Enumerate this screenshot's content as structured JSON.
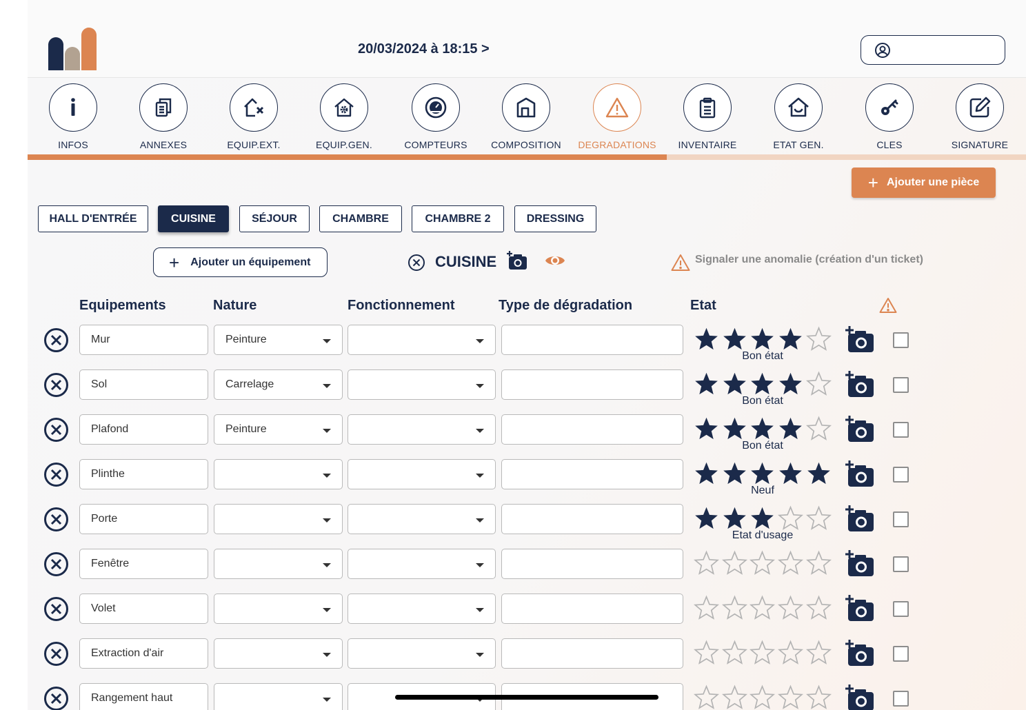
{
  "header": {
    "datetime": "20/03/2024 à 18:15 >",
    "user_name": ""
  },
  "colors": {
    "navy": "#1b2a4a",
    "accent": "#dc8551",
    "logo_mid": "#b2a291"
  },
  "steps": [
    {
      "label": "INFOS",
      "icon": "info-icon",
      "active": false
    },
    {
      "label": "ANNEXES",
      "icon": "documents-icon",
      "active": false
    },
    {
      "label": "EQUIP.EXT.",
      "icon": "house-exterior-icon",
      "active": false
    },
    {
      "label": "EQUIP.GEN.",
      "icon": "house-gear-icon",
      "active": false
    },
    {
      "label": "COMPTEURS",
      "icon": "gauge-icon",
      "active": false
    },
    {
      "label": "COMPOSITION",
      "icon": "floorplan-icon",
      "active": false
    },
    {
      "label": "DEGRADATIONS",
      "icon": "warning-icon",
      "active": true
    },
    {
      "label": "INVENTAIRE",
      "icon": "clipboard-icon",
      "active": false
    },
    {
      "label": "ETAT GEN.",
      "icon": "house-smile-icon",
      "active": false
    },
    {
      "label": "CLES",
      "icon": "key-icon",
      "active": false
    },
    {
      "label": "SIGNATURE",
      "icon": "edit-icon",
      "active": false
    }
  ],
  "progress": 0.64,
  "add_room_label": "Ajouter une pièce",
  "rooms": [
    {
      "label": "HALL D'ENTRÉE",
      "active": false
    },
    {
      "label": "CUISINE",
      "active": true
    },
    {
      "label": "SÉJOUR",
      "active": false
    },
    {
      "label": "CHAMBRE",
      "active": false
    },
    {
      "label": "CHAMBRE 2",
      "active": false
    },
    {
      "label": "DRESSING",
      "active": false
    }
  ],
  "add_equipment_label": "Ajouter un équipement",
  "current_room": "CUISINE",
  "anomaly_label": "Signaler une anomalie (création d'un ticket)",
  "columns": {
    "equipements": "Equipements",
    "nature": "Nature",
    "fonctionnement": "Fonctionnement",
    "degradation": "Type de dégradation",
    "etat": "Etat"
  },
  "rows": [
    {
      "equipement": "Mur",
      "nature": "Peinture",
      "fonctionnement": "",
      "degradation": "",
      "stars": 4,
      "etat": "Bon état",
      "checked": false
    },
    {
      "equipement": "Sol",
      "nature": "Carrelage",
      "fonctionnement": "",
      "degradation": "",
      "stars": 4,
      "etat": "Bon état",
      "checked": false
    },
    {
      "equipement": "Plafond",
      "nature": "Peinture",
      "fonctionnement": "",
      "degradation": "",
      "stars": 4,
      "etat": "Bon état",
      "checked": false
    },
    {
      "equipement": "Plinthe",
      "nature": "",
      "fonctionnement": "",
      "degradation": "",
      "stars": 5,
      "etat": "Neuf",
      "checked": false
    },
    {
      "equipement": "Porte",
      "nature": "",
      "fonctionnement": "",
      "degradation": "",
      "stars": 3,
      "etat": "Etat d'usage",
      "checked": false
    },
    {
      "equipement": "Fenêtre",
      "nature": "",
      "fonctionnement": "",
      "degradation": "",
      "stars": 0,
      "etat": "",
      "checked": false
    },
    {
      "equipement": "Volet",
      "nature": "",
      "fonctionnement": "",
      "degradation": "",
      "stars": 0,
      "etat": "",
      "checked": false
    },
    {
      "equipement": "Extraction d'air",
      "nature": "",
      "fonctionnement": "",
      "degradation": "",
      "stars": 0,
      "etat": "",
      "checked": false
    },
    {
      "equipement": "Rangement haut",
      "nature": "",
      "fonctionnement": "",
      "degradation": "",
      "stars": 0,
      "etat": "",
      "checked": false
    }
  ]
}
